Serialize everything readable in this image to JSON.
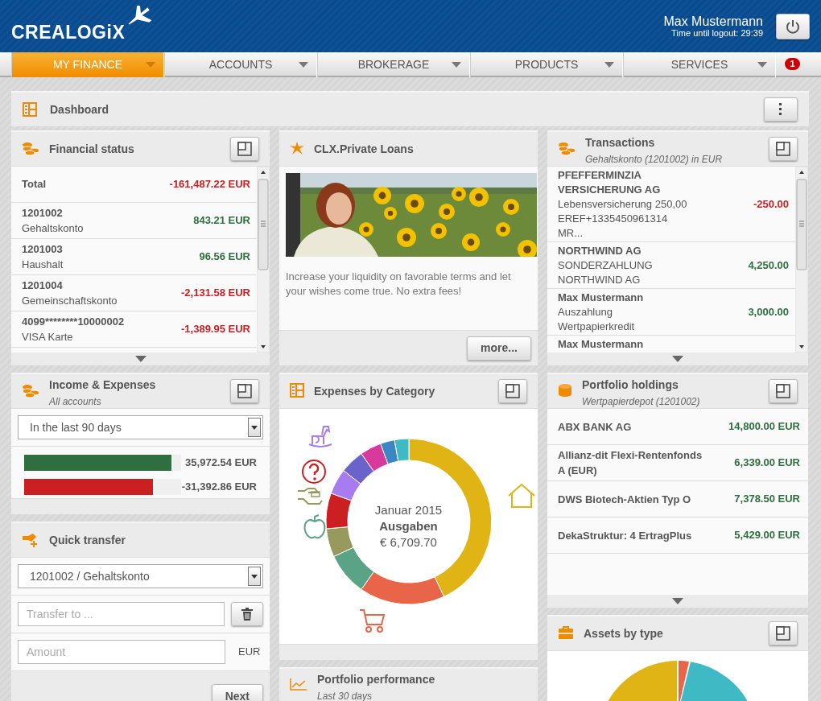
{
  "header": {
    "logo": "CREALOGiX",
    "user": "Max Mustermann",
    "logout_timer": "Time until logout: 29:39"
  },
  "nav": {
    "tabs": [
      {
        "label": "MY FINANCE",
        "selected": true
      },
      {
        "label": "ACCOUNTS",
        "selected": false
      },
      {
        "label": "BROKERAGE",
        "selected": false
      },
      {
        "label": "PRODUCTS",
        "selected": false
      },
      {
        "label": "SERVICES",
        "selected": false
      }
    ],
    "notifications": "1"
  },
  "dashboard": {
    "title": "Dashboard"
  },
  "financial_status": {
    "title": "Financial status",
    "total": {
      "label": "Total",
      "amount": "-161,487.22 EUR",
      "kind": "negative"
    },
    "rows": [
      {
        "number": "1201002",
        "name": "Gehaltskonto",
        "amount": "843.21 EUR",
        "kind": "positive"
      },
      {
        "number": "1201003",
        "name": "Haushalt",
        "amount": "96.56 EUR",
        "kind": "positive"
      },
      {
        "number": "1201004",
        "name": "Gemeinschaftskonto",
        "amount": "-2,131.58 EUR",
        "kind": "negative"
      },
      {
        "number": "4099********10000002",
        "name": "VISA Karte",
        "amount": "-1,389.95 EUR",
        "kind": "negative"
      }
    ]
  },
  "income_expenses": {
    "title": "Income & Expenses",
    "subtitle": "All accounts",
    "period": "In the last 90 days",
    "bars": [
      {
        "kind": "income",
        "level": 0.94,
        "amount": "35,972.54 EUR"
      },
      {
        "kind": "expense",
        "level": 0.82,
        "amount": "-31,392.86 EUR"
      }
    ]
  },
  "quick_transfer": {
    "title": "Quick transfer",
    "account": "1201002 / Gehaltskonto",
    "recipient": {
      "placeholder": "Transfer to ..."
    },
    "amount": {
      "placeholder": "Amount"
    },
    "currency": "EUR",
    "next": "Next"
  },
  "private_loans": {
    "title": "CLX.Private Loans",
    "text": "Increase your liquidity on favorable terms and let your wishes come true. No extra fees!",
    "more": "more..."
  },
  "expenses_by_category": {
    "title": "Expenses by Category",
    "month": "Januar 2015",
    "label": "Ausgaben",
    "total": "€ 6,709.70"
  },
  "portfolio_performance": {
    "title": "Portfolio performance",
    "subtitle": "Last 30 days"
  },
  "transactions": {
    "title": "Transactions",
    "subtitle": "Gehaltskonto (1201002) in EUR",
    "rows": [
      {
        "party": "PFEFFERMINZIA VERSICHERUNG AG",
        "details": [
          "Lebensversicherung 250,00",
          "EREF+1335450961314",
          "MR..."
        ],
        "amount": "-250.00",
        "kind": "negative"
      },
      {
        "party": "NORTHWIND AG",
        "details": [
          "SONDERZAHLUNG",
          "NORTHWIND AG"
        ],
        "amount": "4,250.00",
        "kind": "positive"
      },
      {
        "party": "Max Mustermann",
        "details": [
          "Auszahlung",
          "Wertpapierkredit"
        ],
        "amount": "3,000.00",
        "kind": "positive"
      },
      {
        "party": "Max Mustermann"
      }
    ]
  },
  "portfolio_holdings": {
    "title": "Portfolio holdings",
    "subtitle": "Wertpapierdepot (1201002)",
    "rows": [
      {
        "name": "ABX BANK AG",
        "amount": "14,800.00 EUR"
      },
      {
        "name": "Allianz-dit Flexi-Rentenfonds A (EUR)",
        "amount": "6,339.00 EUR"
      },
      {
        "name": "DWS Biotech-Aktien Typ O",
        "amount": "7,378.50 EUR"
      },
      {
        "name": "DekaStruktur: 4 ErtragPlus",
        "amount": "5,429.00 EUR"
      }
    ]
  },
  "assets_by_type": {
    "title": "Assets by type"
  }
}
